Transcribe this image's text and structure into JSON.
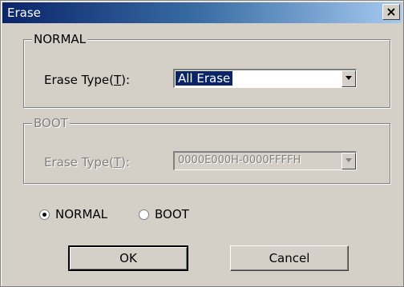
{
  "window": {
    "title": "Erase",
    "close_glyph": "×"
  },
  "normal_group": {
    "legend": "NORMAL",
    "erase_type_label": "Erase Type(",
    "erase_type_mnemonic": "T",
    "erase_type_label_end": "):",
    "erase_type_value": "All Erase"
  },
  "boot_group": {
    "legend": "BOOT",
    "erase_type_label": "Erase Type(",
    "erase_type_mnemonic": "T",
    "erase_type_label_end": "):",
    "erase_type_value": "0000E000H-0000FFFFH"
  },
  "mode": {
    "normal_label": "NORMAL",
    "boot_label": "BOOT",
    "selected": "NORMAL"
  },
  "buttons": {
    "ok": "OK",
    "cancel": "Cancel"
  },
  "icons": {
    "combo_arrow": "triangle-down-icon",
    "radio_on": "radio-selected-icon",
    "radio_off": "radio-unselected-icon"
  }
}
